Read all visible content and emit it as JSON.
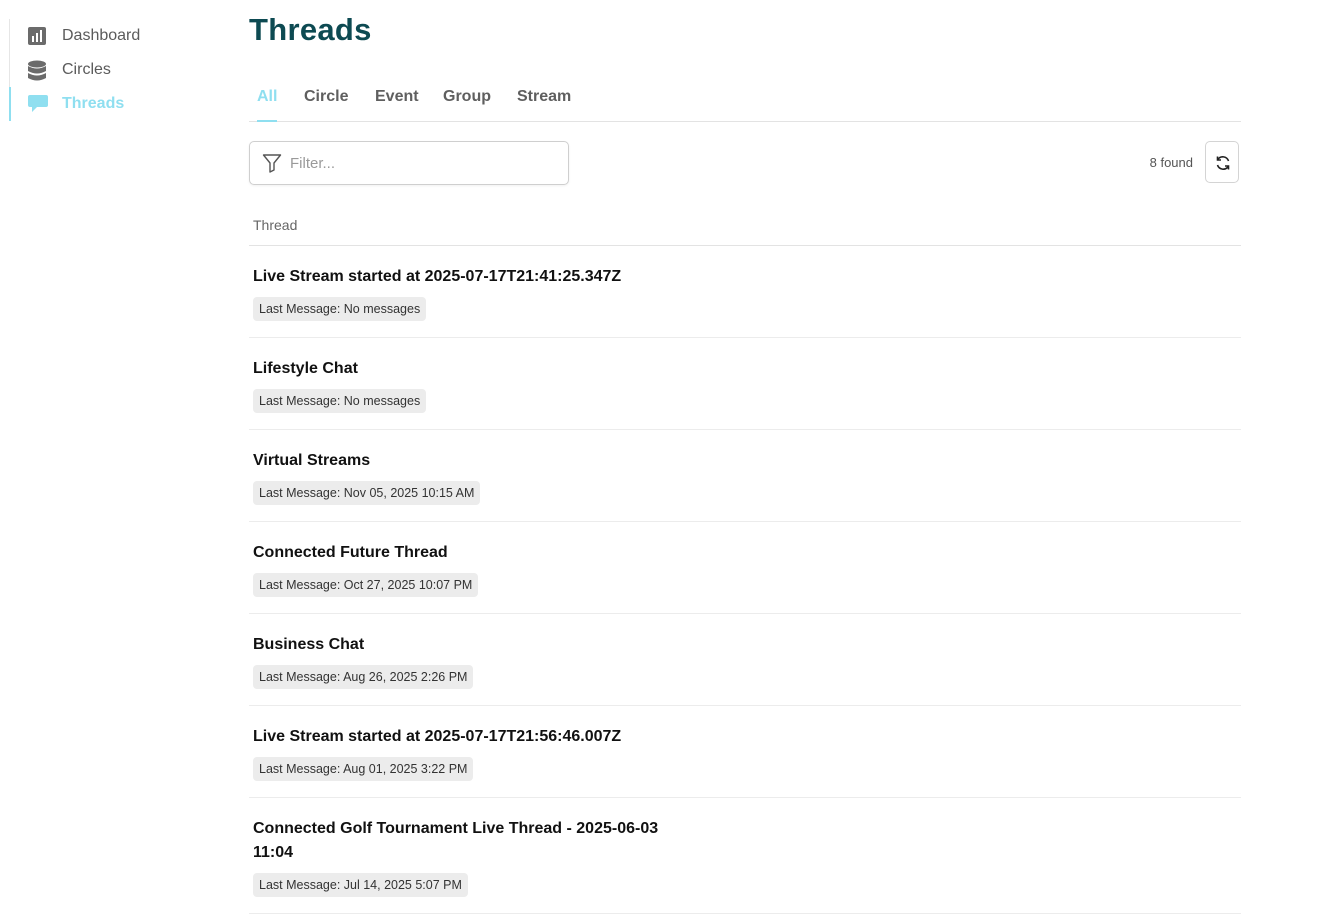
{
  "sidebar": {
    "items": [
      {
        "label": "Dashboard",
        "icon": "bar-chart-icon",
        "active": false
      },
      {
        "label": "Circles",
        "icon": "database-icon",
        "active": false
      },
      {
        "label": "Threads",
        "icon": "chat-bubble-icon",
        "active": true
      }
    ]
  },
  "page": {
    "title": "Threads"
  },
  "tabs": [
    {
      "label": "All",
      "active": true
    },
    {
      "label": "Circle",
      "active": false
    },
    {
      "label": "Event",
      "active": false
    },
    {
      "label": "Group",
      "active": false
    },
    {
      "label": "Stream",
      "active": false
    }
  ],
  "filter": {
    "placeholder": "Filter...",
    "value": ""
  },
  "results": {
    "count_text": "8 found"
  },
  "table": {
    "column_header": "Thread",
    "rows": [
      {
        "title": "Live Stream started at 2025-07-17T21:41:25.347Z",
        "last_message": "Last Message: No messages"
      },
      {
        "title": "Lifestyle Chat",
        "last_message": "Last Message: No messages"
      },
      {
        "title": "Virtual Streams",
        "last_message": "Last Message: Nov 05, 2025 10:15 AM"
      },
      {
        "title": "Connected Future Thread",
        "last_message": "Last Message: Oct 27, 2025 10:07 PM"
      },
      {
        "title": "Business Chat",
        "last_message": "Last Message: Aug 26, 2025 2:26 PM"
      },
      {
        "title": "Live Stream started at 2025-07-17T21:56:46.007Z",
        "last_message": "Last Message: Aug 01, 2025 3:22 PM"
      },
      {
        "title": "Connected Golf Tournament Live Thread - 2025-06-03 11:04",
        "last_message": "Last Message: Jul 14, 2025 5:07 PM"
      }
    ]
  },
  "colors": {
    "accent": "#8fdff0",
    "title": "#0d4a52",
    "muted": "#5b5b5b"
  }
}
